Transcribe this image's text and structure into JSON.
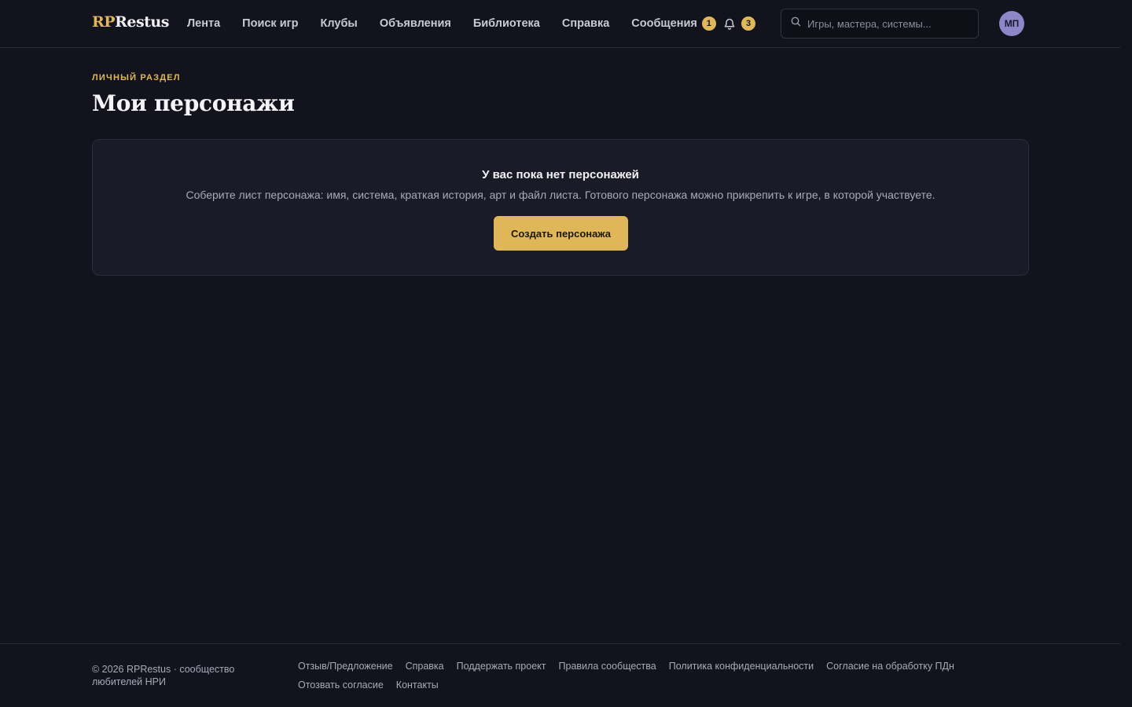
{
  "header": {
    "logo_rp": "RP",
    "logo_rest": "Restus",
    "nav": [
      {
        "label": "Лента"
      },
      {
        "label": "Поиск игр"
      },
      {
        "label": "Клубы"
      },
      {
        "label": "Объявления"
      },
      {
        "label": "Библиотека"
      },
      {
        "label": "Справка"
      },
      {
        "label": "Сообщения",
        "badge": "1"
      }
    ],
    "notifications_badge": "3",
    "search_placeholder": "Игры, мастера, системы...",
    "avatar_initials": "МП",
    "accent_color": "#e0b85a"
  },
  "main": {
    "eyebrow": "ЛИЧНЫЙ РАЗДЕЛ",
    "title": "Мои персонажи",
    "empty_state": {
      "title": "У вас пока нет персонажей",
      "description": "Соберите лист персонажа: имя, система, краткая история, арт и файл листа. Готового персонажа можно прикрепить к игре, в которой участвуете.",
      "button_label": "Создать персонажа"
    }
  },
  "footer": {
    "copyright": "© 2026 RPRestus · сообщество любителей НРИ",
    "links": [
      {
        "label": "Отзыв/Предложение"
      },
      {
        "label": "Справка"
      },
      {
        "label": "Поддержать проект"
      },
      {
        "label": "Правила сообщества"
      },
      {
        "label": "Политика конфиденциальности"
      },
      {
        "label": "Согласие на обработку ПДн"
      },
      {
        "label": "Отозвать согласие"
      },
      {
        "label": "Контакты"
      }
    ]
  }
}
